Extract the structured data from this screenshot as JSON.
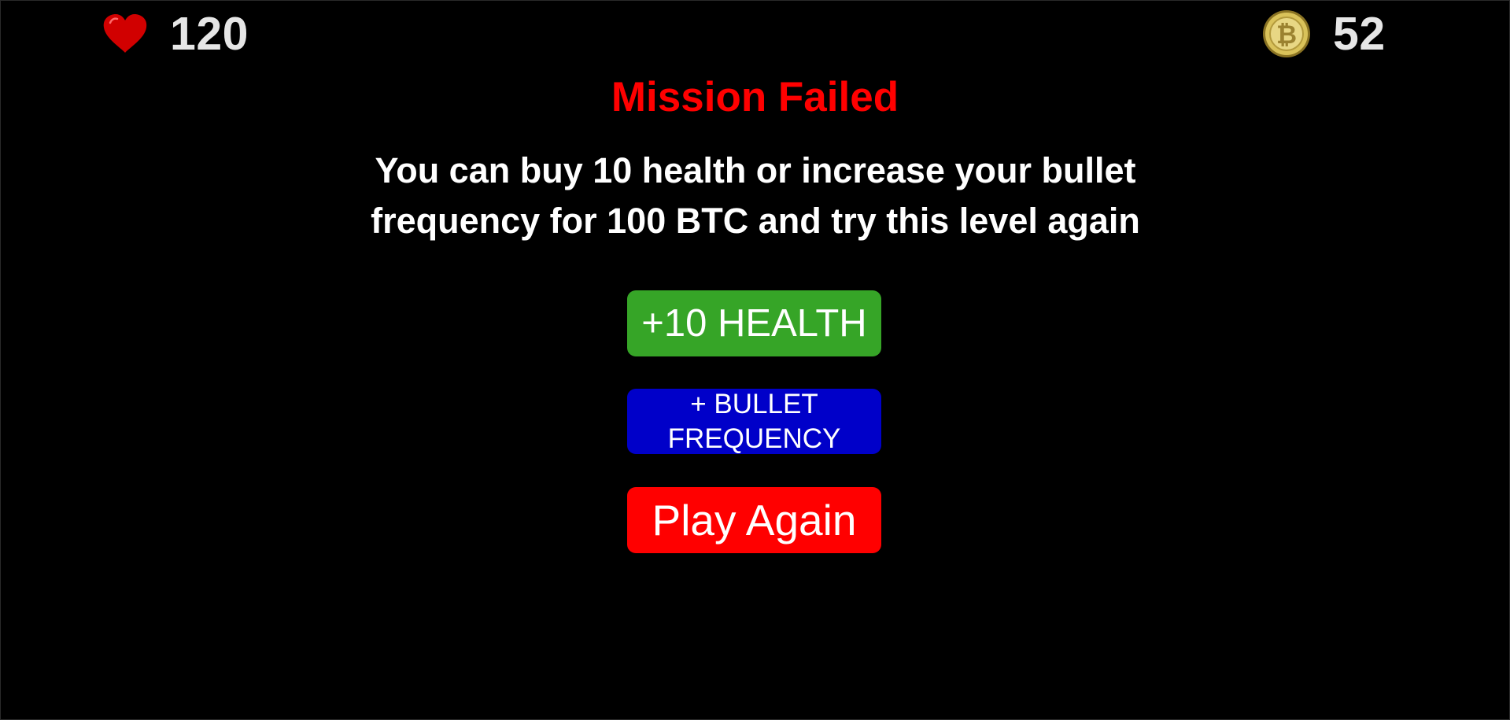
{
  "hud": {
    "health": {
      "icon": "heart-icon",
      "value": "120"
    },
    "coins": {
      "icon": "bitcoin-icon",
      "value": "52"
    }
  },
  "dialog": {
    "title": "Mission Failed",
    "message": "You can buy 10 health or increase your bullet frequency for 100 BTC and try this level again"
  },
  "buttons": {
    "health": "+10 HEALTH",
    "bullet_frequency": "+ BULLET FREQUENCY",
    "play_again": "Play Again"
  },
  "colors": {
    "background": "#000000",
    "title": "#ff0000",
    "health_button": "#36a527",
    "bullet_button": "#0000c9",
    "play_button": "#ff0000",
    "heart": "#d10000",
    "coin": "#d9c25a"
  }
}
